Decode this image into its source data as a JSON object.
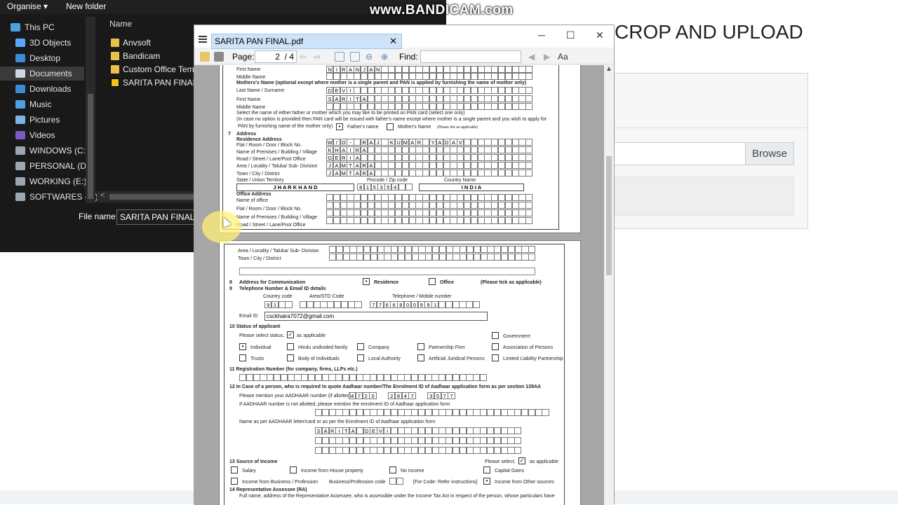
{
  "explorer": {
    "toolbar": {
      "organise": "Organise ▾",
      "new_folder": "New folder"
    },
    "nav": [
      {
        "label": "This PC",
        "color": "#4aa3df"
      },
      {
        "label": "3D Objects",
        "color": "#58a6ff"
      },
      {
        "label": "Desktop",
        "color": "#3d8bd6"
      },
      {
        "label": "Documents",
        "color": "#cfd8e3"
      },
      {
        "label": "Downloads",
        "color": "#3d8bd6"
      },
      {
        "label": "Music",
        "color": "#4aa3df"
      },
      {
        "label": "Pictures",
        "color": "#7fb4e6"
      },
      {
        "label": "Videos",
        "color": "#7a5bc4"
      },
      {
        "label": "WINDOWS (C:)",
        "color": "#9ea7b1"
      },
      {
        "label": "PERSONAL (D:)",
        "color": "#9ea7b1"
      },
      {
        "label": "WORKING (E:)",
        "color": "#9ea7b1"
      },
      {
        "label": "SOFTWARES (F:)",
        "color": "#9ea7b1"
      }
    ],
    "column_header": "Name",
    "files": [
      "Anvsoft",
      "Bandicam",
      "Custom Office Temp",
      "SARITA PAN FINAL"
    ],
    "file_name_label": "File name:",
    "file_name_value": "SARITA PAN FINAL"
  },
  "web": {
    "title": "CROP AND UPLOAD",
    "browse": "Browse"
  },
  "watermark": "www.BANDICAM.com",
  "viewer": {
    "tab_title": "SARITA PAN FINAL.pdf",
    "page_label": "Page:",
    "page_current": "2",
    "page_total": "/ 4",
    "find_label": "Find:",
    "win_min": "─",
    "win_max": "☐",
    "win_close": "✕",
    "page1": {
      "first_name_label": "First Name",
      "first_name": [
        "N",
        "I",
        "R",
        "A",
        "N",
        "J",
        "A",
        "N"
      ],
      "middle_name_label": "Middle Name",
      "mother_label": "Mothers's Name (optional except where mother is a single parent and PAN is applied by furnishing the name of mother only)",
      "last_name_label": "Last Name / Surname",
      "last_name": [
        "D",
        "E",
        "V",
        "I"
      ],
      "m_first_name_label": "First Name",
      "m_first_name": [
        "S",
        "A",
        "R",
        "I",
        "T",
        "A"
      ],
      "m_middle_name_label": "Middle Name",
      "select_note": "Select the name of either father or mother which you may like to be printed on PAN card (select one only)",
      "case_note": "(In case no option is provided then PAN card will be issued with father's name except where mother is a single parent and you wish to apply for",
      "pan_note": "PAN by furnishing name of the mother only)",
      "fathers_name": "Father's name",
      "mothers_name": "Mother's Name",
      "tick_note": "(Please tick as applicable)",
      "sec7": "7",
      "address_label": "Address",
      "res_address": "Residence Address",
      "flat_label": "Flat / Room / Door / Block No.",
      "flat": [
        "W",
        "/",
        "O",
        "-",
        "",
        "R",
        "A",
        "J",
        "",
        "K",
        "U",
        "M",
        "A",
        "R",
        "",
        "Y",
        "A",
        "D",
        "A",
        "V"
      ],
      "premises_label": "Name of Premises / Building / Village",
      "premises": [
        "K",
        "H",
        "A",
        "I",
        "R",
        "A"
      ],
      "road_label": "Road / Street / Lane/Post Office",
      "road": [
        "G",
        "E",
        "R",
        "I",
        "A"
      ],
      "area_label": "Area / Locality / Taluka/ Sub- Division",
      "area": [
        "J",
        "A",
        "M",
        "T",
        "A",
        "R",
        "A"
      ],
      "town_label": "Town / City / District",
      "town": [
        "J",
        "A",
        "M",
        "T",
        "A",
        "R",
        "A"
      ],
      "state_label": "State / Union Territory",
      "pin_label": "Pincode / Zip code",
      "country_label": "Country Name",
      "state": "J H A R K H A N D",
      "pin": [
        "8",
        "1",
        "5",
        "3",
        "5",
        "4"
      ],
      "country": "I N D I A",
      "office_address": "Office Address",
      "office_name": "Name of office",
      "o_flat": "Flat / Room / Door / Block No.",
      "o_premises": "Name of Premises / Building / Village",
      "o_road": "Road / Street / Lane/Post Office"
    },
    "page2": {
      "area_label": "Area / Locality / Taluka/ Sub- Division",
      "town_label": "Town / City / District",
      "sec8": "8",
      "comm_label": "Address for Communication",
      "residence": "Residence",
      "office": "Office",
      "tick": "(Please tick as applicable)",
      "sec9": "9",
      "tel_label": "Telephone Number & Email ID details",
      "country_code": "Country code",
      "area_std": "Area/STD Code",
      "tel_mobile": "Telephone / Mobile number",
      "cc": [
        "9",
        "1"
      ],
      "mobile": [
        "7",
        "7",
        "6",
        "6",
        "8",
        "0",
        "0",
        "9",
        "9",
        "1"
      ],
      "email_label": "Email ID",
      "email": "csckhaira7072@gmail.com",
      "sec10": "10 Status of applicant",
      "select_status": "Please select status,",
      "as_applicable": "as applicable",
      "government": "Government",
      "individual": "Individual",
      "huf": "Hindu undivided family",
      "company": "Company",
      "partnership": "Partnership Firm",
      "aop": "Association of Persons",
      "trusts": "Trusts",
      "boi": "Body of Individuals",
      "local_auth": "Local Authority",
      "ajp": "Artificial Juridical Persons",
      "llp": "Limited Liability Partnership",
      "sec11": "11  Registration Number (for company, firms, LLPs etc.)",
      "sec12": "12 In Case of a person, who is required to quote Aadhaar number/The Enrolment ID of Aadhaar application form as per section 139AA",
      "aadhaar_label": "Please mention your AADHAAR number (if allotted)",
      "aadhaar1": [
        "4",
        "7",
        "2",
        "0"
      ],
      "aadhaar2": [
        "2",
        "8",
        "4",
        "7"
      ],
      "aadhaar3": [
        "3",
        "5",
        "7",
        "7"
      ],
      "enrol_label": "If AADHAAR number is not allotted, please mention the enrolment ID of Aadhaar application form",
      "name_aadhaar_label": "Name as per AADHAAR letter/card or as per the Enrolment ID of Aadhaar application form",
      "name_aadhaar": [
        "S",
        "A",
        "R",
        "I",
        "T",
        "A",
        "",
        "D",
        "E",
        "V",
        "I"
      ],
      "sec13": "13    Source of Income",
      "please_select": "Please select,",
      "as_app2": "as applicable",
      "salary": "Salary",
      "house_prop": "Income from House property",
      "no_income": "No income",
      "capital_gains": "Capital Gains",
      "business": "Income from Business / Profession",
      "bp_code": "Business/Profession code",
      "refer": "[For Code: Refer instructions]",
      "other_src": "Income from Other sources",
      "sec14": "14 Representative Assessee (RA)",
      "ra_note": "Full name, address of the Representative Assessee, who is assessible under the Income Tax Act in respect of the person, whose particulars have"
    }
  }
}
